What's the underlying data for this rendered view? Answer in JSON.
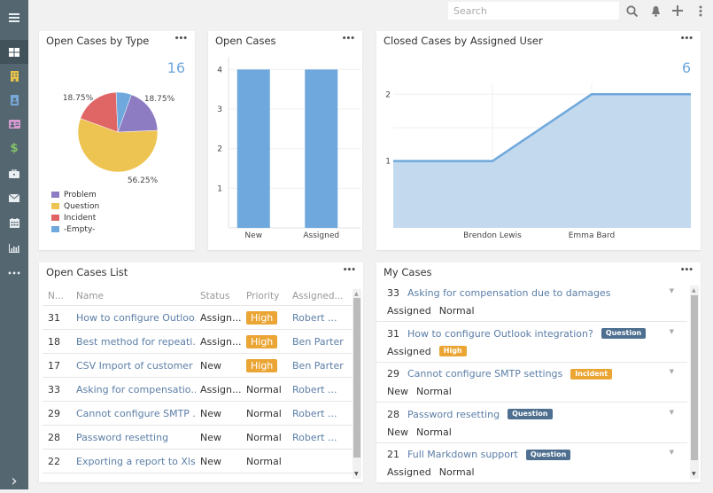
{
  "sidebar": {
    "items": [
      {
        "name": "menu-icon",
        "glyph": "≡"
      },
      {
        "name": "dashboard-icon",
        "glyph": ""
      },
      {
        "name": "accounts-icon",
        "glyph": ""
      },
      {
        "name": "contacts-icon",
        "glyph": ""
      },
      {
        "name": "leads-icon",
        "glyph": ""
      },
      {
        "name": "opportunities-icon",
        "glyph": "$"
      },
      {
        "name": "cases-icon",
        "glyph": ""
      },
      {
        "name": "email-icon",
        "glyph": ""
      },
      {
        "name": "calendar-icon",
        "glyph": ""
      },
      {
        "name": "reports-icon",
        "glyph": ""
      },
      {
        "name": "more-icon",
        "glyph": "•••"
      },
      {
        "name": "expand-icon",
        "glyph": "›"
      }
    ],
    "colors": {
      "accounts": "#e6c34a",
      "contacts": "#79a8d8",
      "leads": "#d99bd1",
      "opportunities": "#84c468"
    }
  },
  "topbar": {
    "search_placeholder": "Search"
  },
  "panels": {
    "cases_by_type": {
      "title": "Open Cases by Type",
      "total": "16",
      "menu": "•••"
    },
    "open_cases": {
      "title": "Open Cases",
      "menu": "•••"
    },
    "closed_by_user": {
      "title": "Closed Cases by Assigned User",
      "total": "6",
      "menu": "•••"
    },
    "open_cases_list": {
      "title": "Open Cases List",
      "menu": "•••",
      "columns": [
        "N...",
        "Name",
        "Status",
        "Priority",
        "Assigned..."
      ],
      "rows": [
        {
          "num": "31",
          "name": "How to configure Outloo...",
          "status": "Assign...",
          "priority": "High",
          "priority_badge": true,
          "assigned": "Robert ..."
        },
        {
          "num": "18",
          "name": "Best method for repeati...",
          "status": "Assign...",
          "priority": "High",
          "priority_badge": true,
          "assigned": "Ben Parter"
        },
        {
          "num": "17",
          "name": "CSV Import of customer ...",
          "status": "New",
          "priority": "High",
          "priority_badge": true,
          "assigned": "Ben Parter"
        },
        {
          "num": "33",
          "name": "Asking for compensatio...",
          "status": "Assign...",
          "priority": "Normal",
          "priority_badge": false,
          "assigned": "Robert ..."
        },
        {
          "num": "29",
          "name": "Cannot configure SMTP ...",
          "status": "New",
          "priority": "Normal",
          "priority_badge": false,
          "assigned": "Robert ..."
        },
        {
          "num": "28",
          "name": "Password resetting",
          "status": "New",
          "priority": "Normal",
          "priority_badge": false,
          "assigned": "Robert ..."
        },
        {
          "num": "22",
          "name": "Exporting a report to Xls...",
          "status": "New",
          "priority": "Normal",
          "priority_badge": false,
          "assigned": ""
        }
      ]
    },
    "my_cases": {
      "title": "My Cases",
      "menu": "•••",
      "items": [
        {
          "num": "33",
          "name": "Asking for compensation due to damages",
          "type": "",
          "status": "Assigned",
          "priority": "Normal",
          "priority_badge": false
        },
        {
          "num": "31",
          "name": "How to configure Outlook integration?",
          "type": "Question",
          "status": "Assigned",
          "priority": "High",
          "priority_badge": true
        },
        {
          "num": "29",
          "name": "Cannot configure SMTP settings",
          "type": "Incident",
          "status": "New",
          "priority": "Normal",
          "priority_badge": false
        },
        {
          "num": "28",
          "name": "Password resetting",
          "type": "Question",
          "status": "New",
          "priority": "Normal",
          "priority_badge": false
        },
        {
          "num": "21",
          "name": "Full Markdown support",
          "type": "Question",
          "status": "Assigned",
          "priority": "Normal",
          "priority_badge": false
        }
      ]
    }
  },
  "chart_data": [
    {
      "type": "pie",
      "title": "Open Cases by Type",
      "categories": [
        "Problem",
        "Question",
        "Incident",
        "-Empty-"
      ],
      "values": [
        18.75,
        56.25,
        18.75,
        6.25
      ],
      "labels": [
        "18.75%",
        "56.25%",
        "18.75%",
        ""
      ],
      "colors": [
        "#8e7cc3",
        "#edc451",
        "#e06666",
        "#6fa8dc"
      ],
      "legend": "bottom-left"
    },
    {
      "type": "bar",
      "title": "Open Cases",
      "categories": [
        "New",
        "Assigned"
      ],
      "values": [
        4,
        4
      ],
      "yticks": [
        1,
        2,
        3,
        4
      ],
      "ylim": [
        0,
        4.3
      ],
      "color": "#6fa8dc"
    },
    {
      "type": "area",
      "title": "Closed Cases by Assigned User",
      "x_points": [
        0,
        1,
        2,
        3
      ],
      "values": [
        1,
        1,
        2,
        2
      ],
      "xtick_labels": [
        {
          "pos": 1,
          "label": "Brendon Lewis"
        },
        {
          "pos": 2,
          "label": "Emma Bard"
        }
      ],
      "yticks": [
        1,
        2
      ],
      "ylim": [
        0,
        2.15
      ],
      "color": "#6fa8dc",
      "fill": "#c3d9ee"
    }
  ]
}
